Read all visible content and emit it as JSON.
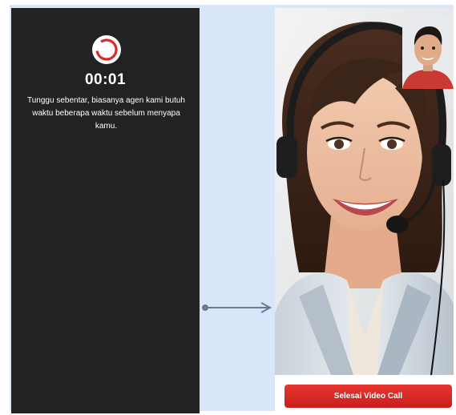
{
  "waiting": {
    "timer": "00:01",
    "message": "Tunggu sebentar, biasanya agen kami butuh waktu beberapa waktu sebelum menyapa kamu.",
    "icon": "loading-spinner-icon"
  },
  "call": {
    "end_button_label": "Selesai Video Call",
    "agent_video": "customer-service-agent-video",
    "self_view": "self-camera-preview"
  },
  "colors": {
    "accent_red": "#d92a26",
    "dark_panel": "#222222",
    "background": "#d9e6f9",
    "arrow": "#6d7891"
  }
}
